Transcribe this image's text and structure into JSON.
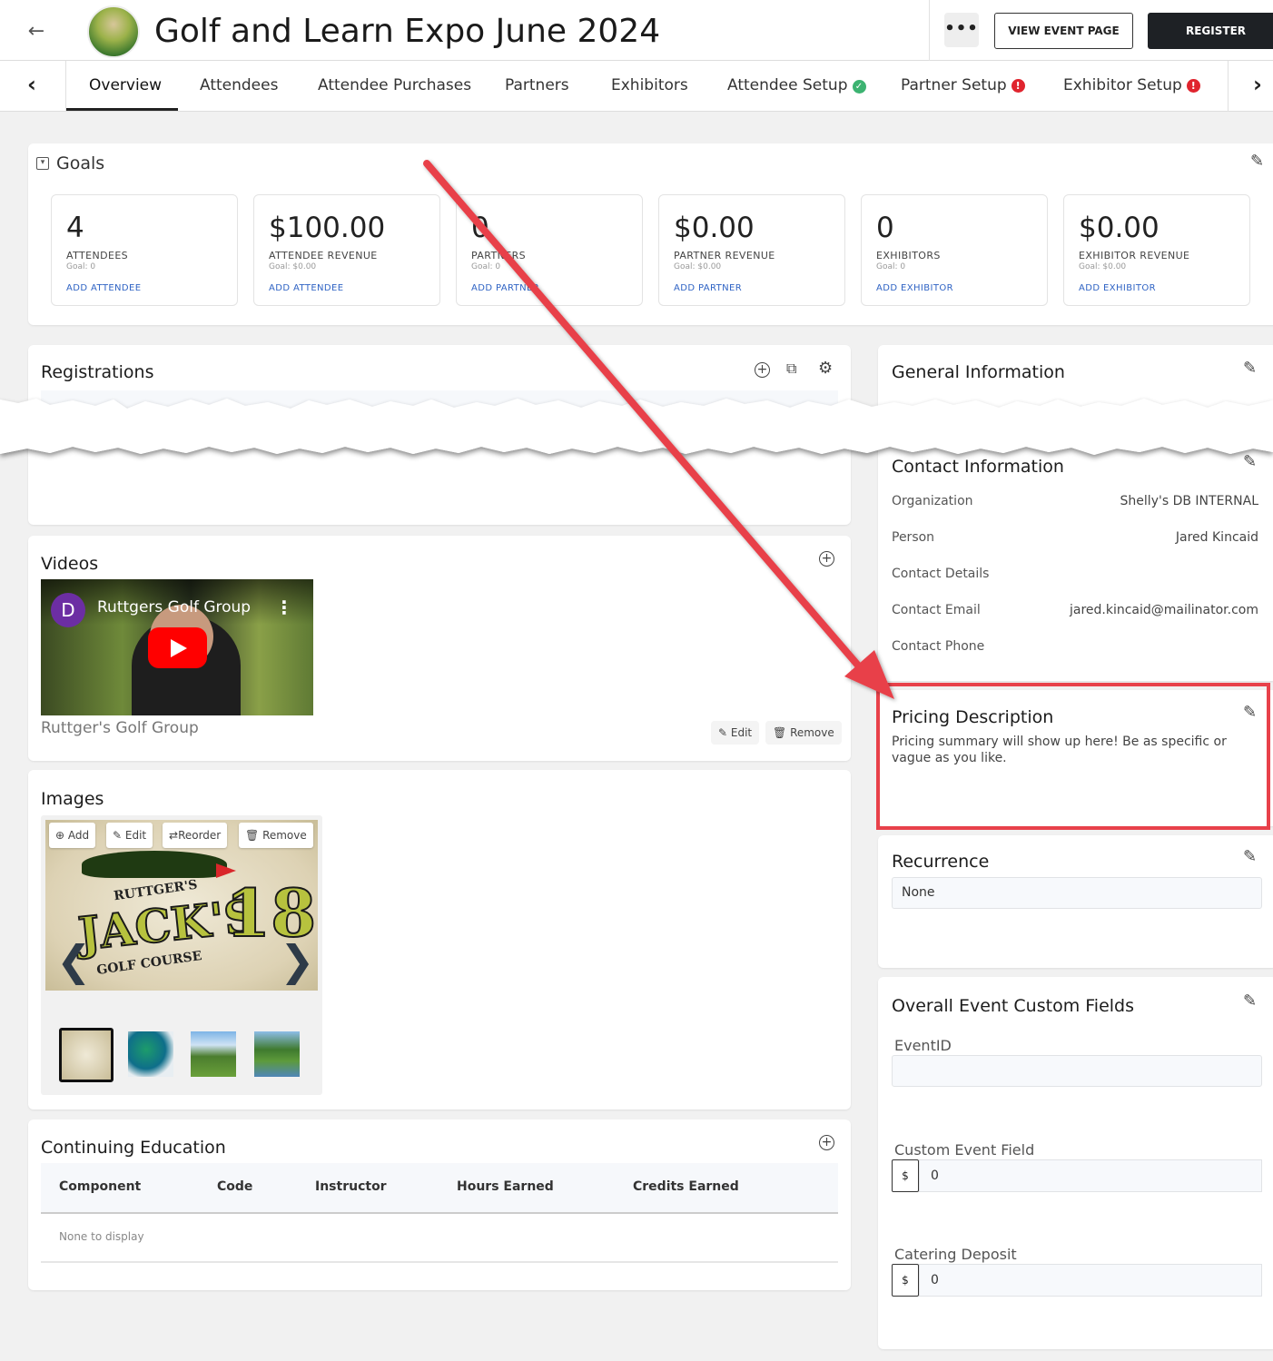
{
  "header": {
    "title": "Golf and Learn Expo June 2024",
    "more_label": "•••",
    "view_event_label": "VIEW EVENT PAGE",
    "register_label": "REGISTER"
  },
  "tabs": [
    {
      "label": "Overview",
      "active": true
    },
    {
      "label": "Attendees"
    },
    {
      "label": "Attendee Purchases"
    },
    {
      "label": "Partners"
    },
    {
      "label": "Exhibitors"
    },
    {
      "label": "Attendee Setup",
      "status": "ok"
    },
    {
      "label": "Partner Setup",
      "status": "error"
    },
    {
      "label": "Exhibitor Setup",
      "status": "error"
    }
  ],
  "goals": {
    "title": "Goals",
    "cards": [
      {
        "value": "4",
        "label": "ATTENDEES",
        "goal": "Goal: 0",
        "link": "ADD ATTENDEE"
      },
      {
        "value": "$100.00",
        "label": "ATTENDEE REVENUE",
        "goal": "Goal: $0.00",
        "link": "ADD ATTENDEE"
      },
      {
        "value": "0",
        "label": "PARTNERS",
        "goal": "Goal: 0",
        "link": "ADD PARTNER"
      },
      {
        "value": "$0.00",
        "label": "PARTNER REVENUE",
        "goal": "Goal: $0.00",
        "link": "ADD PARTNER"
      },
      {
        "value": "0",
        "label": "EXHIBITORS",
        "goal": "Goal: 0",
        "link": "ADD EXHIBITOR"
      },
      {
        "value": "$0.00",
        "label": "EXHIBITOR REVENUE",
        "goal": "Goal: $0.00",
        "link": "ADD EXHIBITOR"
      }
    ]
  },
  "registrations": {
    "title": "Registrations"
  },
  "general_info": {
    "title": "General Information"
  },
  "contact": {
    "title": "Contact Information",
    "rows": [
      {
        "label": "Organization",
        "value": "Shelly's DB INTERNAL"
      },
      {
        "label": "Person",
        "value": "Jared Kincaid"
      },
      {
        "label": "Contact Details",
        "value": ""
      },
      {
        "label": "Contact Email",
        "value": "jared.kincaid@mailinator.com"
      },
      {
        "label": "Contact Phone",
        "value": ""
      }
    ]
  },
  "pricing": {
    "title": "Pricing Description",
    "text": "Pricing summary will show up here! Be as specific or vague as you like."
  },
  "recurrence": {
    "title": "Recurrence",
    "value": "None"
  },
  "custom_fields": {
    "title": "Overall Event Custom Fields",
    "fields": [
      {
        "label": "EventID",
        "value": ""
      },
      {
        "label": "Custom Event Field",
        "prefix": "$",
        "value": "0"
      },
      {
        "label": "Catering Deposit",
        "prefix": "$",
        "value": "0"
      }
    ]
  },
  "videos": {
    "title": "Videos",
    "channel_initial": "D",
    "channel_name": "Ruttgers Golf Group",
    "caption": "Ruttger's Golf Group",
    "edit_label": "Edit",
    "remove_label": "Remove"
  },
  "images": {
    "title": "Images",
    "add_label": "Add",
    "edit_label": "Edit",
    "reorder_label": "Reorder",
    "remove_label": "Remove",
    "logo_top": "RUTTGER'S",
    "logo_main": "JACK'S",
    "logo_num": "18",
    "logo_bottom": "GOLF COURSE"
  },
  "ce": {
    "title": "Continuing Education",
    "columns": [
      "Component",
      "Code",
      "Instructor",
      "Hours Earned",
      "Credits Earned"
    ],
    "empty": "None to display"
  },
  "colors": {
    "annotation_red": "#e8414a",
    "link_blue": "#2f63c4",
    "status_ok": "#3cb371",
    "status_error": "#e0242e"
  }
}
